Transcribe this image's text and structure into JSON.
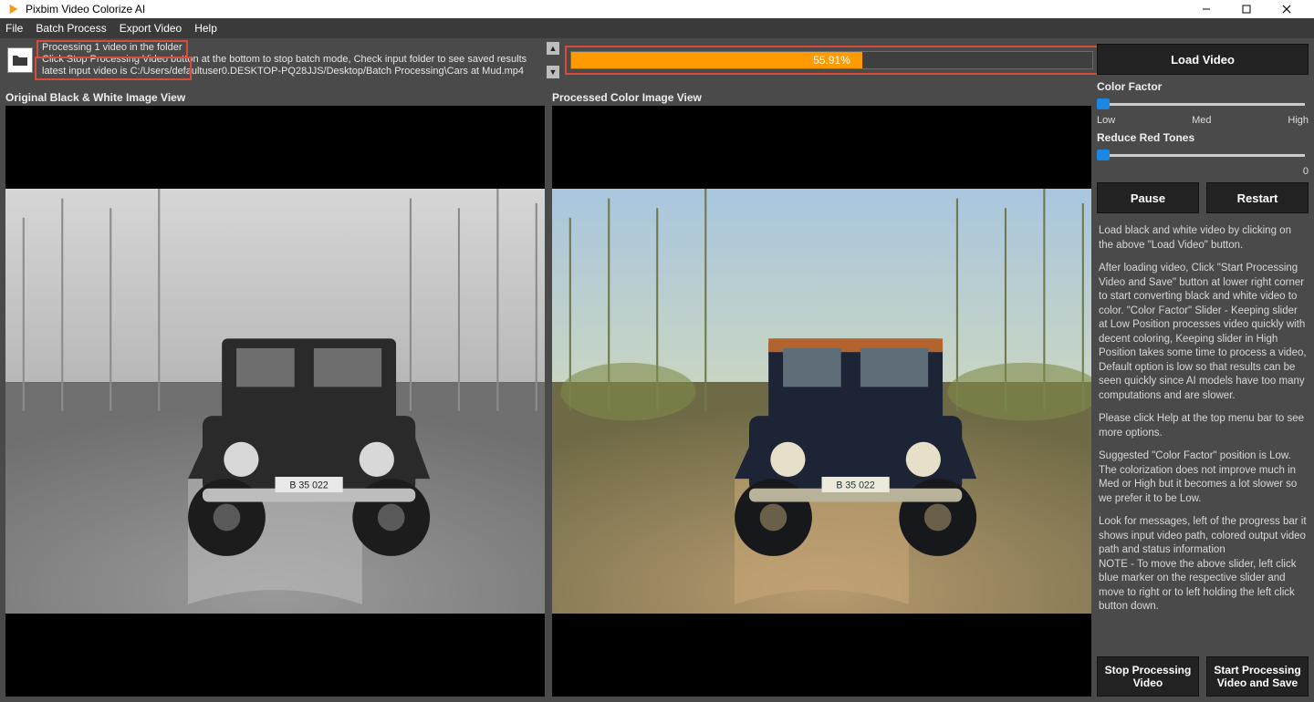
{
  "window": {
    "title": "Pixbim Video Colorize AI"
  },
  "menu": {
    "file": "File",
    "batch": "Batch Process",
    "export": "Export Video",
    "help": "Help"
  },
  "log": {
    "line1": "Processing 1 video in the folder",
    "line2": "Click Stop Processing Video button at the bottom to stop batch mode, Check input folder to see saved results",
    "line3": "latest input video is C:/Users/defaultuser0.DESKTOP-PQ28JJS/Desktop/Batch Processing\\Cars at Mud.mp4"
  },
  "progress": {
    "percent": 55.91,
    "text": "55.91%"
  },
  "buttons": {
    "load_video": "Load Video",
    "pause": "Pause",
    "restart": "Restart",
    "stop": "Stop Processing Video",
    "start": "Start Processing Video and Save"
  },
  "sliders": {
    "color_factor_label": "Color Factor",
    "cf_low": "Low",
    "cf_med": "Med",
    "cf_high": "High",
    "reduce_red_label": "Reduce Red Tones",
    "rr_end": "0"
  },
  "views": {
    "original_label": "Original Black & White Image View",
    "processed_label": "Processed Color Image View"
  },
  "help": {
    "p1": "Load black and white video by clicking on the above \"Load Video\" button.",
    "p2": "After loading video, Click \"Start Processing Video and Save\" button at lower right corner to start converting black and white video to color.",
    "p3": "\"Color Factor\" Slider - Keeping slider at Low Position processes video quickly with decent coloring, Keeping slider in High Position takes some time to process a video, Default option is low so that results can be seen quickly since AI models have too many computations and are slower.",
    "p4": "Please click Help at the top menu bar to see more options.",
    "p5": "Suggested \"Color Factor\" position is Low. The colorization does not improve much in Med or High but it becomes a lot slower so we prefer it to be Low.",
    "p6": "Look for messages, left of the progress bar it shows input video path, colored output video path and status information",
    "p7": "NOTE -  To move the above slider, left click blue marker on the respective slider and move to right or to left holding the left click button down."
  }
}
